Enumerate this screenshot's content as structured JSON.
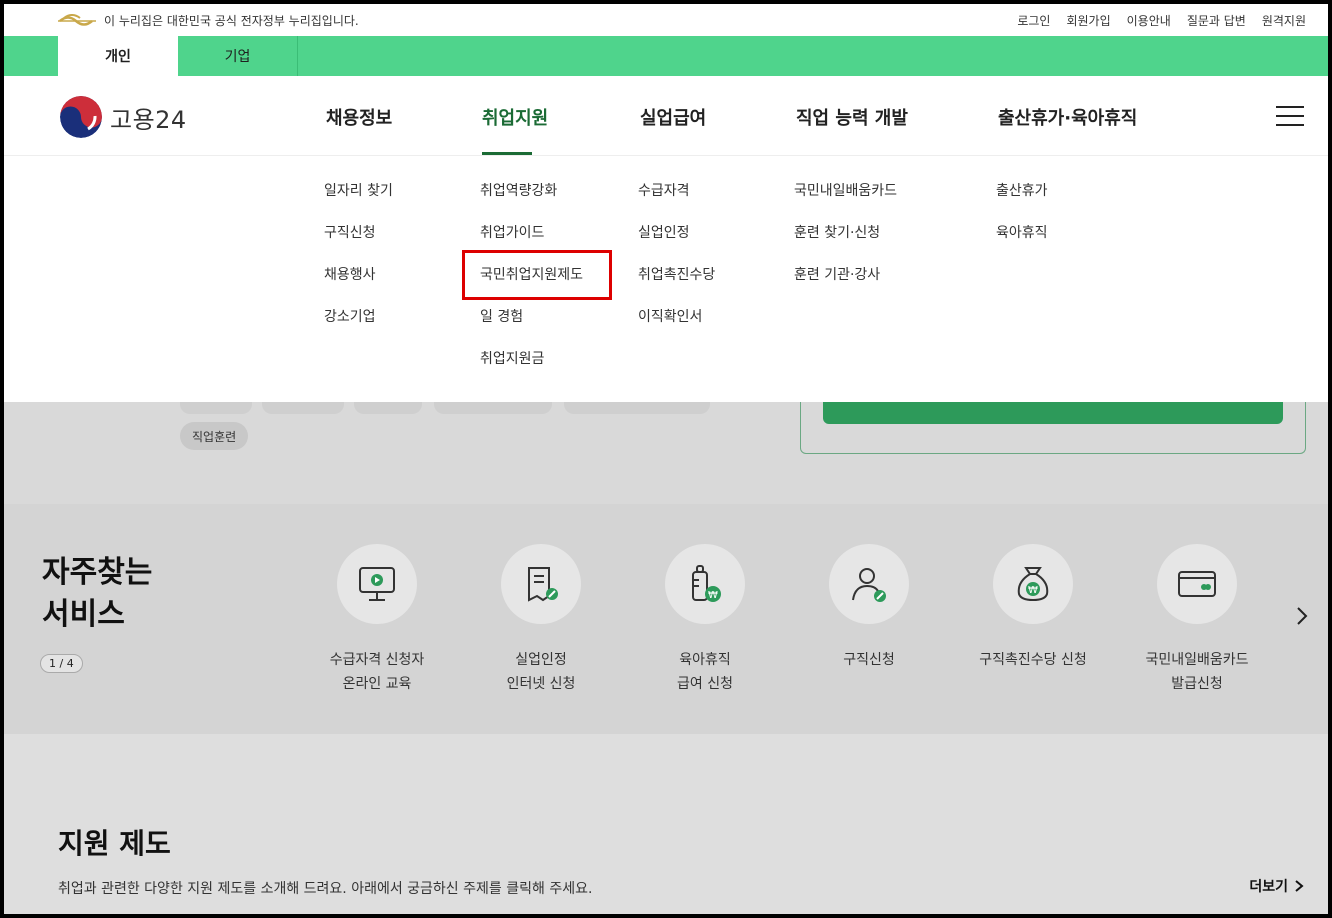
{
  "utility": {
    "notice": "이 누리집은 대한민국 공식 전자정부 누리집입니다.",
    "links": [
      "로그인",
      "회원가입",
      "이용안내",
      "질문과 답변",
      "원격지원"
    ]
  },
  "tabs": {
    "personal": "개인",
    "business": "기업"
  },
  "header": {
    "logo_text": "고용24",
    "gnb": [
      "채용정보",
      "취업지원",
      "실업급여",
      "직업 능력 개발",
      "출산휴가·육아휴직"
    ]
  },
  "mega_menu": {
    "jobs": [
      "일자리 찾기",
      "구직신청",
      "채용행사",
      "강소기업"
    ],
    "employment_support": [
      "취업역량강화",
      "취업가이드",
      "국민취업지원제도",
      "일 경험",
      "취업지원금"
    ],
    "unemployment": [
      "수급자격",
      "실업인정",
      "취업촉진수당",
      "이직확인서"
    ],
    "training": [
      "국민내일배움카드",
      "훈련 찾기·신청",
      "훈련 기관·강사"
    ],
    "leave": [
      "출산휴가",
      "육아휴직"
    ]
  },
  "chip": "직업훈련",
  "services": {
    "title_line1": "자주찾는",
    "title_line2": "서비스",
    "page": "1 / 4",
    "items": [
      {
        "label": "수급자격 신청자\n온라인 교육",
        "icon": "monitor-play-icon"
      },
      {
        "label": "실업인정\n인터넷 신청",
        "icon": "document-edit-icon"
      },
      {
        "label": "육아휴직\n급여 신청",
        "icon": "baby-bottle-won-icon"
      },
      {
        "label": "구직신청",
        "icon": "person-edit-icon"
      },
      {
        "label": "구직촉진수당 신청",
        "icon": "money-bag-won-icon"
      },
      {
        "label": "국민내일배움카드\n발급신청",
        "icon": "card-icon"
      }
    ]
  },
  "support": {
    "title": "지원 제도",
    "description": "취업과 관련한 다양한 지원 제도를 소개해 드려요. 아래에서 궁금하신 주제를 클릭해 주세요.",
    "more": "더보기"
  },
  "colors": {
    "green_bar": "#4fd48c",
    "accent": "#1b6b35",
    "highlight": "#dd0000"
  }
}
